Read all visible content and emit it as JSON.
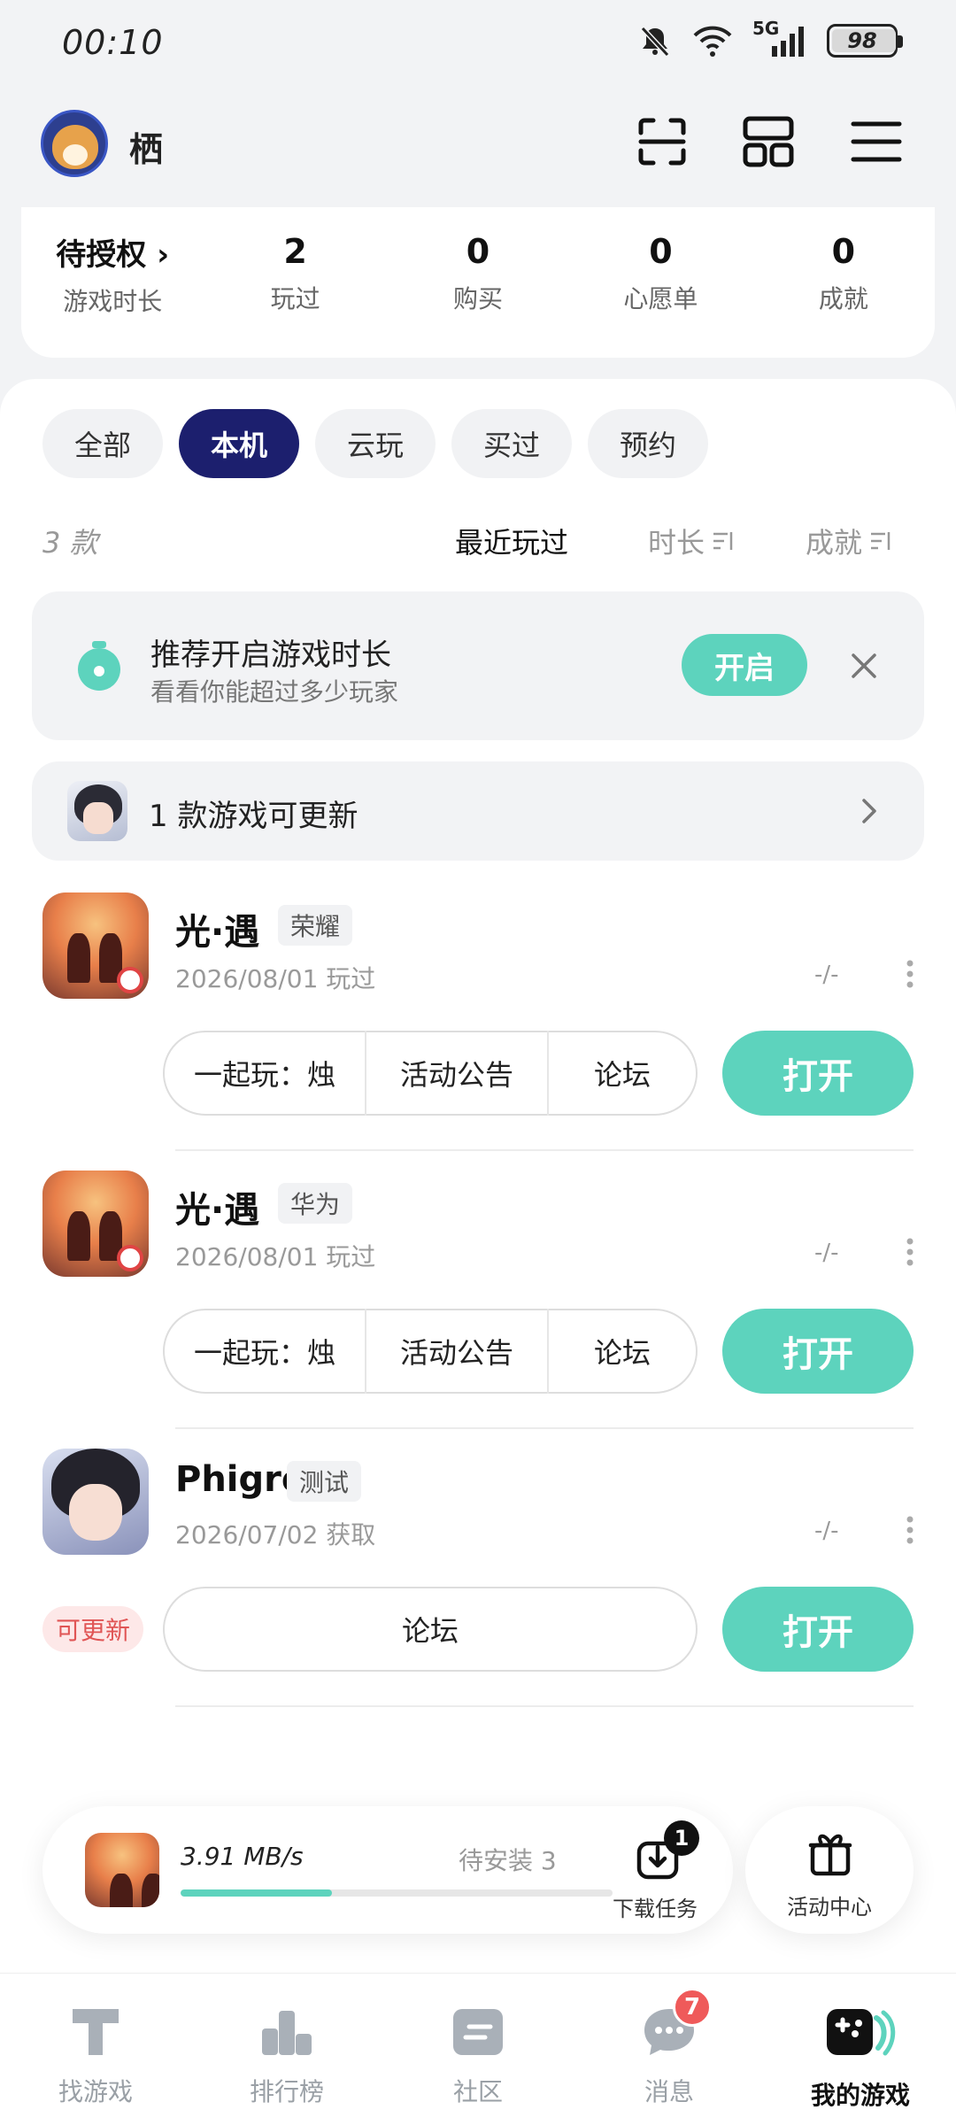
{
  "status_bar": {
    "time": "00:10",
    "network": "5G",
    "battery": "98"
  },
  "header": {
    "username": "栖"
  },
  "stats": [
    {
      "value": "待授权",
      "label": "游戏时长"
    },
    {
      "value": "2",
      "label": "玩过"
    },
    {
      "value": "0",
      "label": "购买"
    },
    {
      "value": "0",
      "label": "心愿单"
    },
    {
      "value": "0",
      "label": "成就"
    }
  ],
  "filters": [
    "全部",
    "本机",
    "云玩",
    "买过",
    "预约"
  ],
  "filter_active": "本机",
  "sort": {
    "count": "3 款",
    "recent": "最近玩过",
    "duration": "时长",
    "achievement": "成就"
  },
  "tip": {
    "title": "推荐开启游戏时长",
    "subtitle": "看看你能超过多少玩家",
    "button": "开启"
  },
  "update_notice": {
    "text": "1 款游戏可更新"
  },
  "games": [
    {
      "name": "光·遇",
      "tag": "荣耀",
      "sub": "2026/08/01 玩过",
      "dash": "-/-",
      "actions": [
        "一起玩：烛",
        "活动公告",
        "论坛"
      ],
      "open": "打开"
    },
    {
      "name": "光·遇",
      "tag": "华为",
      "sub": "2026/08/01 玩过",
      "dash": "-/-",
      "actions": [
        "一起玩：烛",
        "活动公告",
        "论坛"
      ],
      "open": "打开"
    },
    {
      "name": "Phigros",
      "tag": "测试",
      "sub": "2026/07/02 获取",
      "dash": "-/-",
      "actions": [
        "论坛"
      ],
      "open": "打开",
      "update_badge": "可更新"
    }
  ],
  "download": {
    "speed": "3.91 MB/s",
    "pending": "待安装 3",
    "progress": 0.35,
    "task_label": "下载任务",
    "task_count": "1"
  },
  "activity_center": {
    "label": "活动中心"
  },
  "bottom_nav": [
    {
      "label": "找游戏",
      "icon": "find-game-icon"
    },
    {
      "label": "排行榜",
      "icon": "ranking-icon"
    },
    {
      "label": "社区",
      "icon": "community-icon"
    },
    {
      "label": "消息",
      "icon": "message-icon",
      "badge": "7"
    },
    {
      "label": "我的游戏",
      "icon": "my-games-icon",
      "active": true
    }
  ],
  "colors": {
    "accent": "#5dd3bd",
    "active_chip": "#1c1f6e",
    "badge_red": "#ef5a5a"
  }
}
